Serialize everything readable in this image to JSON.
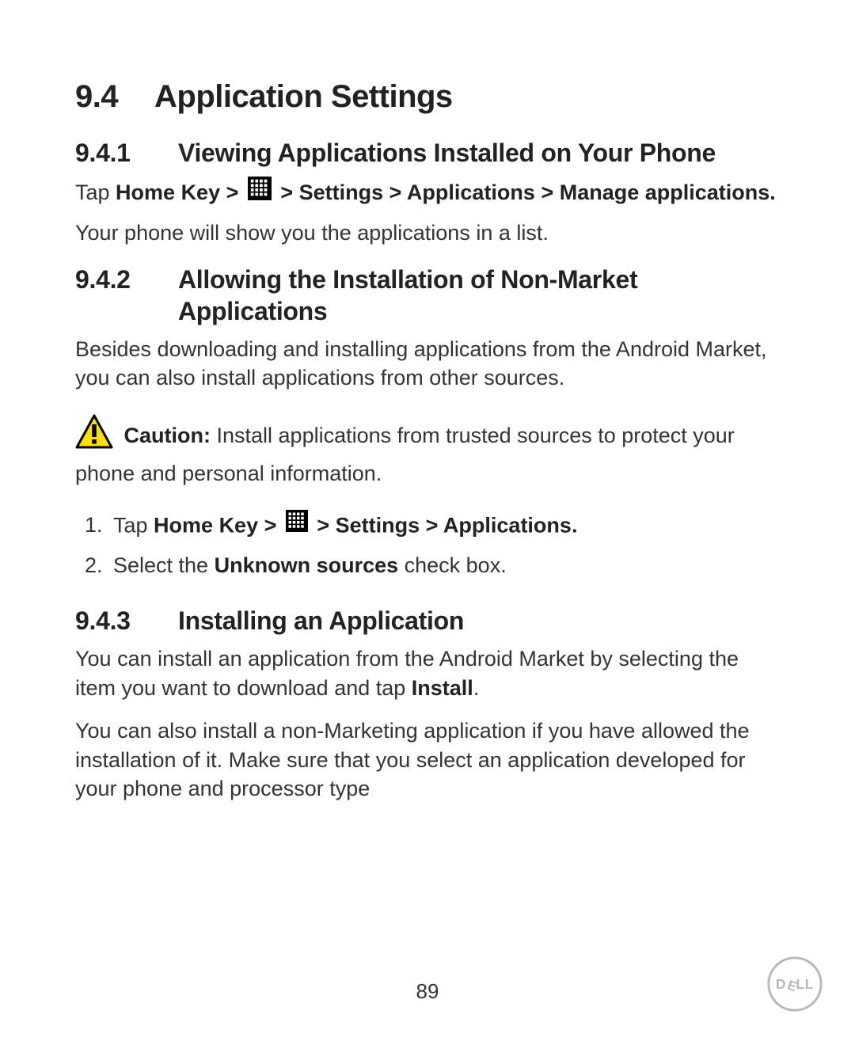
{
  "page": {
    "number": "89"
  },
  "h1": {
    "num": "9.4",
    "title": "Application Settings"
  },
  "sec941": {
    "num": "9.4.1",
    "title": "Viewing Applications Installed on Your Phone",
    "nav_prefix": "Tap ",
    "nav_bold_a": "Home Key > ",
    "nav_bold_b": " > Settings > Applications > Manage applications.",
    "body": "Your phone will show you the applications in a list."
  },
  "sec942": {
    "num": "9.4.2",
    "title": "Allowing the Installation of Non-Market Applications",
    "body": "Besides downloading and installing applications from the Android Market, you can also install applications from other sources.",
    "caution_label": "Caution:",
    "caution_text": " Install applications from trusted sources to protect your phone and personal information.",
    "step1_prefix": "Tap ",
    "step1_bold_a": "Home Key > ",
    "step1_bold_b": " > Settings > Applications.",
    "step2_a": "Select the ",
    "step2_bold": "Unknown sources",
    "step2_b": " check box."
  },
  "sec943": {
    "num": "9.4.3",
    "title": "Installing an Application",
    "p1_a": "You can install an application from the Android Market by selecting the item you want to download and tap ",
    "p1_bold": "Install",
    "p1_b": ".",
    "p2": "You can also install a non-Marketing application if you have allowed the installation of it. Make sure that you select an application developed for your phone and processor type"
  },
  "icons": {
    "grid": "apps-grid-icon",
    "warning": "warning-triangle-icon",
    "dell": "dell-logo"
  },
  "colors": {
    "warning_fill": "#ffe100",
    "warning_stroke": "#000000",
    "logo_stroke": "#9c9c9c"
  }
}
